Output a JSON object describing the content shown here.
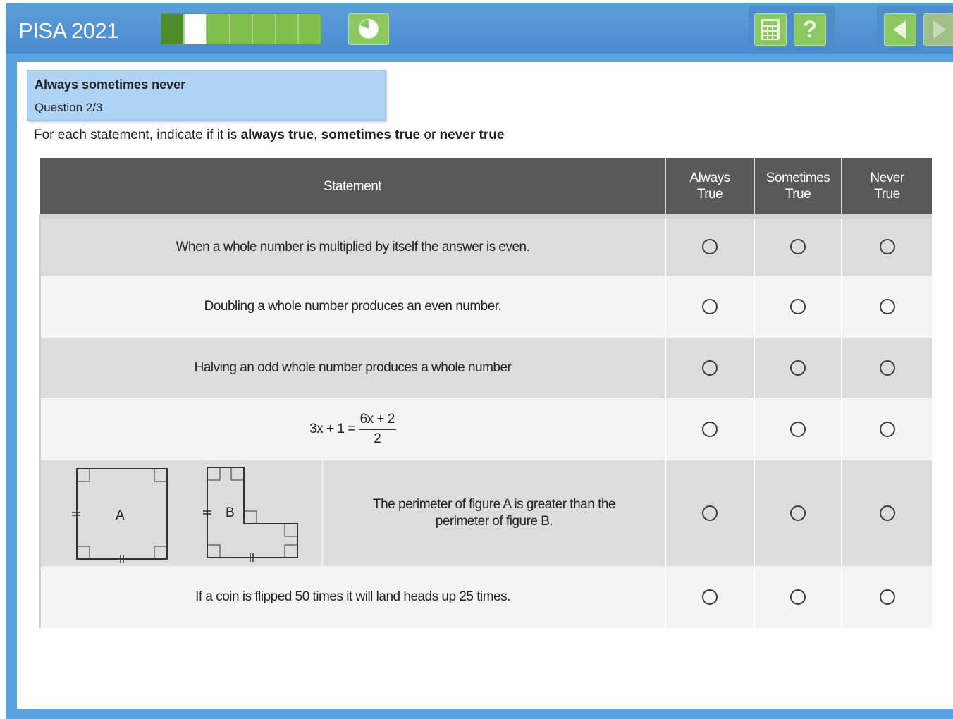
{
  "app": {
    "brand": "PISA 2021"
  },
  "progress": {
    "segments": 7,
    "done": 1,
    "current": 2
  },
  "toolbar": {
    "help_label": "?"
  },
  "question": {
    "title": "Always sometimes never",
    "number": "Question 2/3",
    "instruction_prefix": "For each statement, indicate if it is ",
    "opt1": "always true",
    "sep1": ", ",
    "opt2": "sometimes true",
    "sep2": " or ",
    "opt3": "never true"
  },
  "table": {
    "headers": {
      "statement": "Statement",
      "always": [
        "Always",
        "True"
      ],
      "sometimes": [
        "Sometimes",
        "True"
      ],
      "never": [
        "Never",
        "True"
      ]
    },
    "rows": [
      {
        "text": "When a whole number is multiplied by itself the answer is even."
      },
      {
        "text": "Doubling a whole number produces an even number."
      },
      {
        "text": "Halving an odd whole number produces a whole number"
      },
      {
        "eq_left": "3x + 1 =",
        "eq_num": "6x + 2",
        "eq_den": "2"
      },
      {
        "text": "The perimeter of figure A is greater than the perimeter of figure B.",
        "fig_a": "A",
        "fig_b": "B"
      },
      {
        "text": "If a coin is flipped 50 times it will land heads up 25 times."
      }
    ]
  },
  "colors": {
    "topbar": "#4a8bcf",
    "button_green": "#8bc960",
    "header_gray": "#595959"
  }
}
